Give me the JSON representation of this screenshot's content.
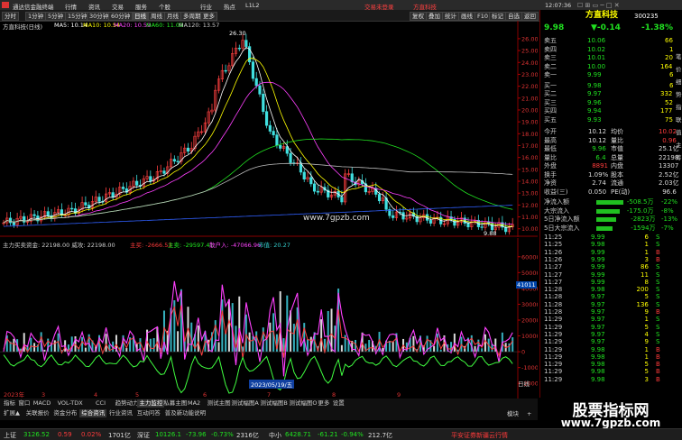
{
  "app": {
    "title": "通达信金融终端",
    "ad1": "交易未登录",
    "ad2": "方直科技",
    "time": "12:07:36"
  },
  "menu": {
    "items": [
      "行情",
      "资讯",
      "交易",
      "服务",
      "个股",
      "行业",
      "热点",
      "L1L2"
    ],
    "periods": [
      "分时",
      "1分钟",
      "5分钟",
      "15分钟",
      "30分钟",
      "60分钟",
      "日线",
      "周线",
      "月线",
      "多周期",
      "更多"
    ],
    "right_buttons": [
      "复权",
      "叠加",
      "统计",
      "画线",
      "F10",
      "标记",
      "自选",
      "返回"
    ]
  },
  "chart": {
    "title": "方直科技(日线)",
    "ma": [
      {
        "label": "MA5: 10.14",
        "color": "#ffffff"
      },
      {
        "label": "MA10: 10.54",
        "color": "#ffff00"
      },
      {
        "label": "MA20: 10.59",
        "color": "#ff40ff"
      },
      {
        "label": "MA60: 11.09",
        "color": "#20e020"
      },
      {
        "label": "MA120: 13.57",
        "color": "#c0c0c0"
      }
    ],
    "high_label": "26.30",
    "low_label": "9.88",
    "watermark": "www.7gpzb.com",
    "y_ticks": [
      "26.00",
      "25.00",
      "24.00",
      "23.00",
      "22.00",
      "21.00",
      "20.00",
      "19.00",
      "18.00",
      "17.00",
      "16.00",
      "15.00",
      "14.00",
      "13.00",
      "12.00",
      "11.00",
      "10.00"
    ],
    "sub_title": "主力买卖资金: 22198.00  威攻: 22198.00",
    "sub_values": [
      "主买: -2666.53",
      "主卖: -29597.41",
      "散户入: -47066.96",
      "市值: 20.27"
    ],
    "sub_ticks": [
      "60000",
      "50000",
      "40000",
      "30000",
      "20000",
      "10000",
      "0",
      "-10000",
      "-20000"
    ],
    "sub_cursor": "41011",
    "date_label": "2023/05/19/五",
    "x_labels": [
      "2023年",
      "3",
      "4",
      "5",
      "6",
      "7",
      "8",
      "9"
    ],
    "weekly": "日线"
  },
  "bottom_tabs": {
    "row1": [
      "指标",
      "窗口",
      "MACD",
      "VOL-TDX",
      "CCI",
      "趋势动力",
      "主力监控",
      "私募主图",
      "MA2",
      "测试主图",
      "测试幅图A",
      "测试幅图B",
      "测试幅图O",
      "更多",
      "设置"
    ],
    "row2": [
      "扩展▲",
      "关联报价",
      "资金分布",
      "综合资讯",
      "行业资讯",
      "互动问答",
      "普及新功能说明"
    ],
    "right": [
      "模块",
      "+"
    ]
  },
  "quote": {
    "name": "方直科技",
    "code": "300235",
    "price": "9.98",
    "change": "▼-0.14",
    "pct": "-1.38%",
    "sells": [
      {
        "label": "卖五",
        "price": "10.06",
        "vol": "66"
      },
      {
        "label": "卖四",
        "price": "10.02",
        "vol": "1"
      },
      {
        "label": "卖三",
        "price": "10.01",
        "vol": "20"
      },
      {
        "label": "卖二",
        "price": "10.00",
        "vol": "164"
      },
      {
        "label": "卖一",
        "price": "9.99",
        "vol": "6"
      }
    ],
    "buys": [
      {
        "label": "买一",
        "price": "9.98",
        "vol": "6"
      },
      {
        "label": "买二",
        "price": "9.97",
        "vol": "332"
      },
      {
        "label": "买三",
        "price": "9.96",
        "vol": "52"
      },
      {
        "label": "买四",
        "price": "9.94",
        "vol": "177"
      },
      {
        "label": "买五",
        "price": "9.93",
        "vol": "75"
      }
    ],
    "stats": [
      {
        "l1": "今开",
        "v1": "10.12",
        "l2": "均价",
        "v2": "10.02"
      },
      {
        "l1": "最高",
        "v1": "10.12",
        "l2": "量比",
        "v2": "0.96"
      },
      {
        "l1": "最低",
        "v1": "9.96",
        "l2": "市值",
        "v2": "25.1亿"
      },
      {
        "l1": "量比",
        "v1": "6.4",
        "l2": "总量",
        "v2": "22198"
      },
      {
        "l1": "外盘",
        "v1": "8891",
        "l2": "内盘",
        "v2": "13307"
      },
      {
        "l1": "换手",
        "v1": "1.09%",
        "l2": "股本",
        "v2": "2.52亿"
      },
      {
        "l1": "净资",
        "v1": "2.74",
        "l2": "流通",
        "v2": "2.03亿"
      },
      {
        "l1": "收益(三)",
        "v1": "0.050",
        "l2": "PE(动)",
        "v2": "96.6"
      }
    ],
    "flows": [
      {
        "label": "净流入额",
        "value": "-508.5万",
        "pct": "-22%"
      },
      {
        "label": "大宗流入",
        "value": "-175.0万",
        "pct": "-8%"
      },
      {
        "label": "5日净流入额",
        "value": "-2823万",
        "pct": "-13%"
      },
      {
        "label": "5日大宗流入",
        "value": "-1594万",
        "pct": "-7%"
      }
    ],
    "ticks": [
      {
        "t": "11:25",
        "p": "9.99",
        "v": "6",
        "s": "S"
      },
      {
        "t": "11:25",
        "p": "9.98",
        "v": "1",
        "s": "S"
      },
      {
        "t": "11:26",
        "p": "9.99",
        "v": "1",
        "s": "B"
      },
      {
        "t": "11:26",
        "p": "9.99",
        "v": "3",
        "s": "B"
      },
      {
        "t": "11:27",
        "p": "9.99",
        "v": "86",
        "s": "S"
      },
      {
        "t": "11:27",
        "p": "9.99",
        "v": "11",
        "s": "S"
      },
      {
        "t": "11:27",
        "p": "9.99",
        "v": "8",
        "s": "S"
      },
      {
        "t": "11:28",
        "p": "9.98",
        "v": "200",
        "s": "S"
      },
      {
        "t": "11:28",
        "p": "9.97",
        "v": "5",
        "s": "S"
      },
      {
        "t": "11:28",
        "p": "9.97",
        "v": "136",
        "s": "S"
      },
      {
        "t": "11:28",
        "p": "9.97",
        "v": "9",
        "s": "B"
      },
      {
        "t": "11:29",
        "p": "9.97",
        "v": "1",
        "s": "S"
      },
      {
        "t": "11:29",
        "p": "9.97",
        "v": "5",
        "s": "S"
      },
      {
        "t": "11:29",
        "p": "9.97",
        "v": "4",
        "s": "S"
      },
      {
        "t": "11:29",
        "p": "9.97",
        "v": "9",
        "s": "S"
      },
      {
        "t": "11:29",
        "p": "9.98",
        "v": "1",
        "s": "B"
      },
      {
        "t": "11:29",
        "p": "9.98",
        "v": "1",
        "s": "B"
      },
      {
        "t": "11:29",
        "p": "9.98",
        "v": "5",
        "s": "B"
      },
      {
        "t": "11:29",
        "p": "9.98",
        "v": "5",
        "s": "B"
      },
      {
        "t": "11:29",
        "p": "9.98",
        "v": "3",
        "s": "B"
      }
    ],
    "tick_tabs": [
      "笔",
      "价",
      "细",
      "势",
      "指",
      "联",
      "值",
      "主",
      "筹"
    ]
  },
  "watermark_box": {
    "line1": "股票指标网",
    "line2": "www.7gpzb.com"
  },
  "status": {
    "sh_label": "上证",
    "sh_val": "3126.52",
    "sh_chg": "0.59",
    "sh_pct": "0.02%",
    "sh_amt": "1701亿",
    "sz_label": "深证",
    "sz_val": "10126.1",
    "sz_chg": "-73.96",
    "sz_pct": "-0.73%",
    "sz_amt": "2316亿",
    "zx_label": "中小",
    "zx_val": "6428.71",
    "zx_chg": "-61.21",
    "zx_pct": "-0.94%",
    "zx_amt": "212.7亿",
    "news": "平安证券新疆云行情"
  }
}
